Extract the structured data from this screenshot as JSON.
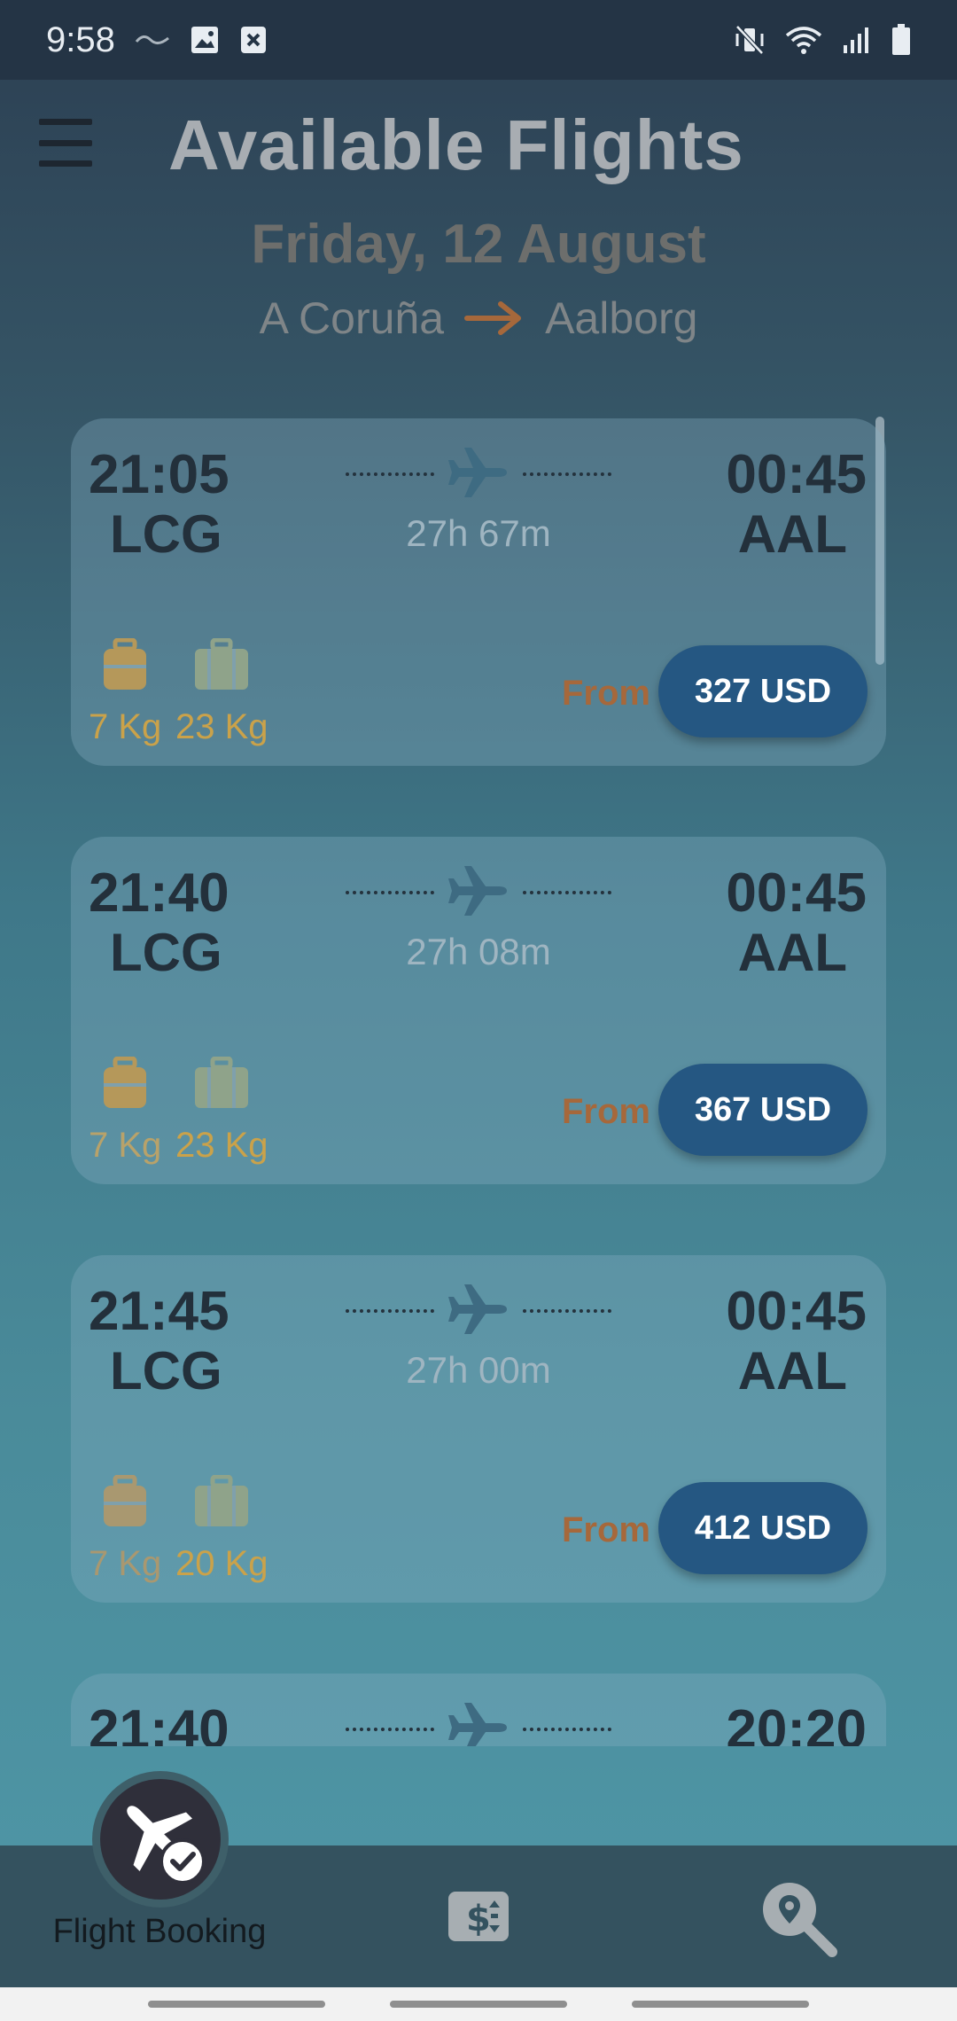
{
  "status_bar": {
    "time": "9:58",
    "left_icons": [
      "wave-icon",
      "image-icon",
      "close-box-icon"
    ],
    "right_icons": [
      "mute-vibrate-icon",
      "wifi-icon",
      "signal-icon",
      "battery-icon"
    ]
  },
  "header": {
    "menu_icon": "hamburger-menu-icon",
    "title": "Available Flights",
    "date": "Friday, 12 August",
    "origin": "A Coruña",
    "destination": "Aalborg",
    "route_arrow_icon": "arrow-right-icon"
  },
  "flights": [
    {
      "departure_time": "21:05",
      "departure_code": "LCG",
      "arrival_time": "00:45",
      "arrival_code": "AAL",
      "duration": "27h 67m",
      "cabin_bag": "7 Kg",
      "checked_bag": "23 Kg",
      "from_label": "From",
      "price": "327 USD"
    },
    {
      "departure_time": "21:40",
      "departure_code": "LCG",
      "arrival_time": "00:45",
      "arrival_code": "AAL",
      "duration": "27h 08m",
      "cabin_bag": "7 Kg",
      "checked_bag": "23 Kg",
      "from_label": "From",
      "price": "367 USD"
    },
    {
      "departure_time": "21:45",
      "departure_code": "LCG",
      "arrival_time": "00:45",
      "arrival_code": "AAL",
      "duration": "27h 00m",
      "cabin_bag": "7 Kg",
      "checked_bag": "20 Kg",
      "from_label": "From",
      "price": "412 USD"
    },
    {
      "departure_time": "21:40",
      "arrival_time": "20:20"
    }
  ],
  "bottom_nav": {
    "active_label": "Flight Booking",
    "items": [
      {
        "icon": "flight-booking-check-icon",
        "label": "Flight Booking"
      },
      {
        "icon": "price-sort-icon"
      },
      {
        "icon": "location-search-icon"
      }
    ]
  },
  "colors": {
    "price_button": "#255782",
    "from_label": "#a6683b",
    "baggage": "#caa24a",
    "text_dark": "#23303b"
  }
}
